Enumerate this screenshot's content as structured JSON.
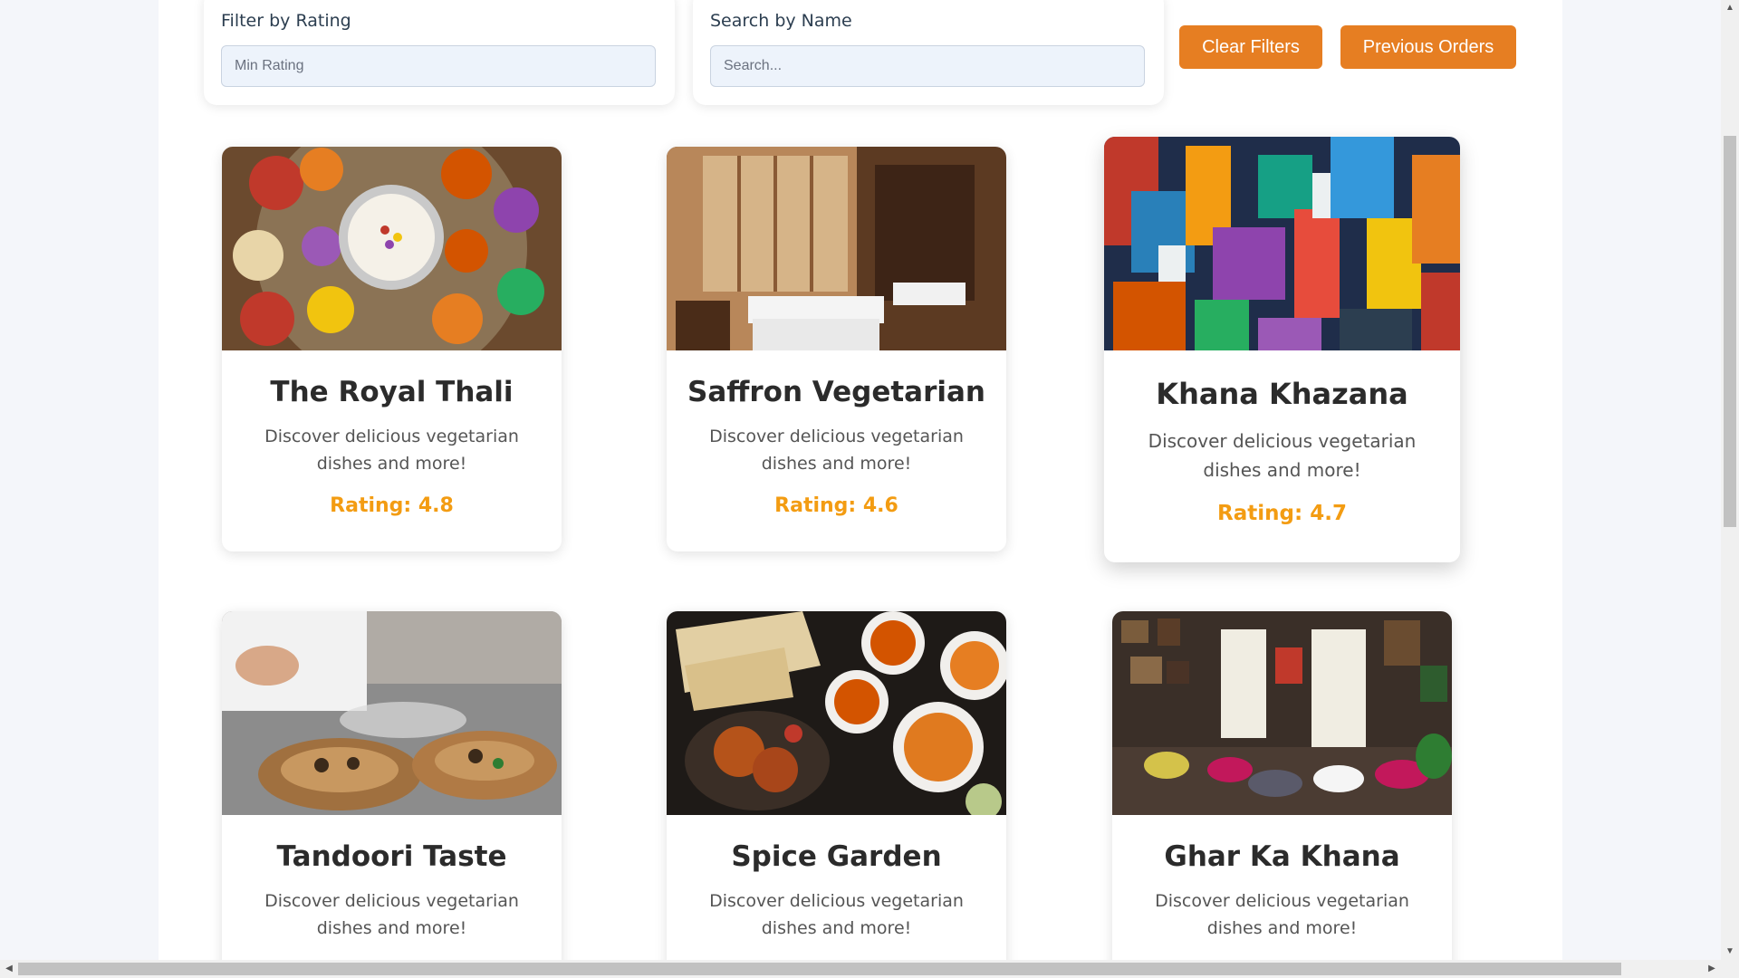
{
  "filters": {
    "rating": {
      "label": "Filter by Rating",
      "placeholder": "Min Rating"
    },
    "name": {
      "label": "Search by Name",
      "placeholder": "Search..."
    },
    "clear_label": "Clear Filters",
    "orders_label": "Previous Orders"
  },
  "colors": {
    "accent": "#e67e22",
    "rating": "#f39c12"
  },
  "restaurants": [
    {
      "name": "The Royal Thali",
      "description": "Discover delicious vegetarian dishes and more!",
      "rating": "Rating: 4.8"
    },
    {
      "name": "Saffron Vegetarian",
      "description": "Discover delicious vegetarian dishes and more!",
      "rating": "Rating: 4.6"
    },
    {
      "name": "Khana Khazana",
      "description": "Discover delicious vegetarian dishes and more!",
      "rating": "Rating: 4.7"
    },
    {
      "name": "Tandoori Taste",
      "description": "Discover delicious vegetarian dishes and more!"
    },
    {
      "name": "Spice Garden",
      "description": "Discover delicious vegetarian dishes and more!"
    },
    {
      "name": "Ghar Ka Khana",
      "description": "Discover delicious vegetarian dishes and more!"
    }
  ]
}
